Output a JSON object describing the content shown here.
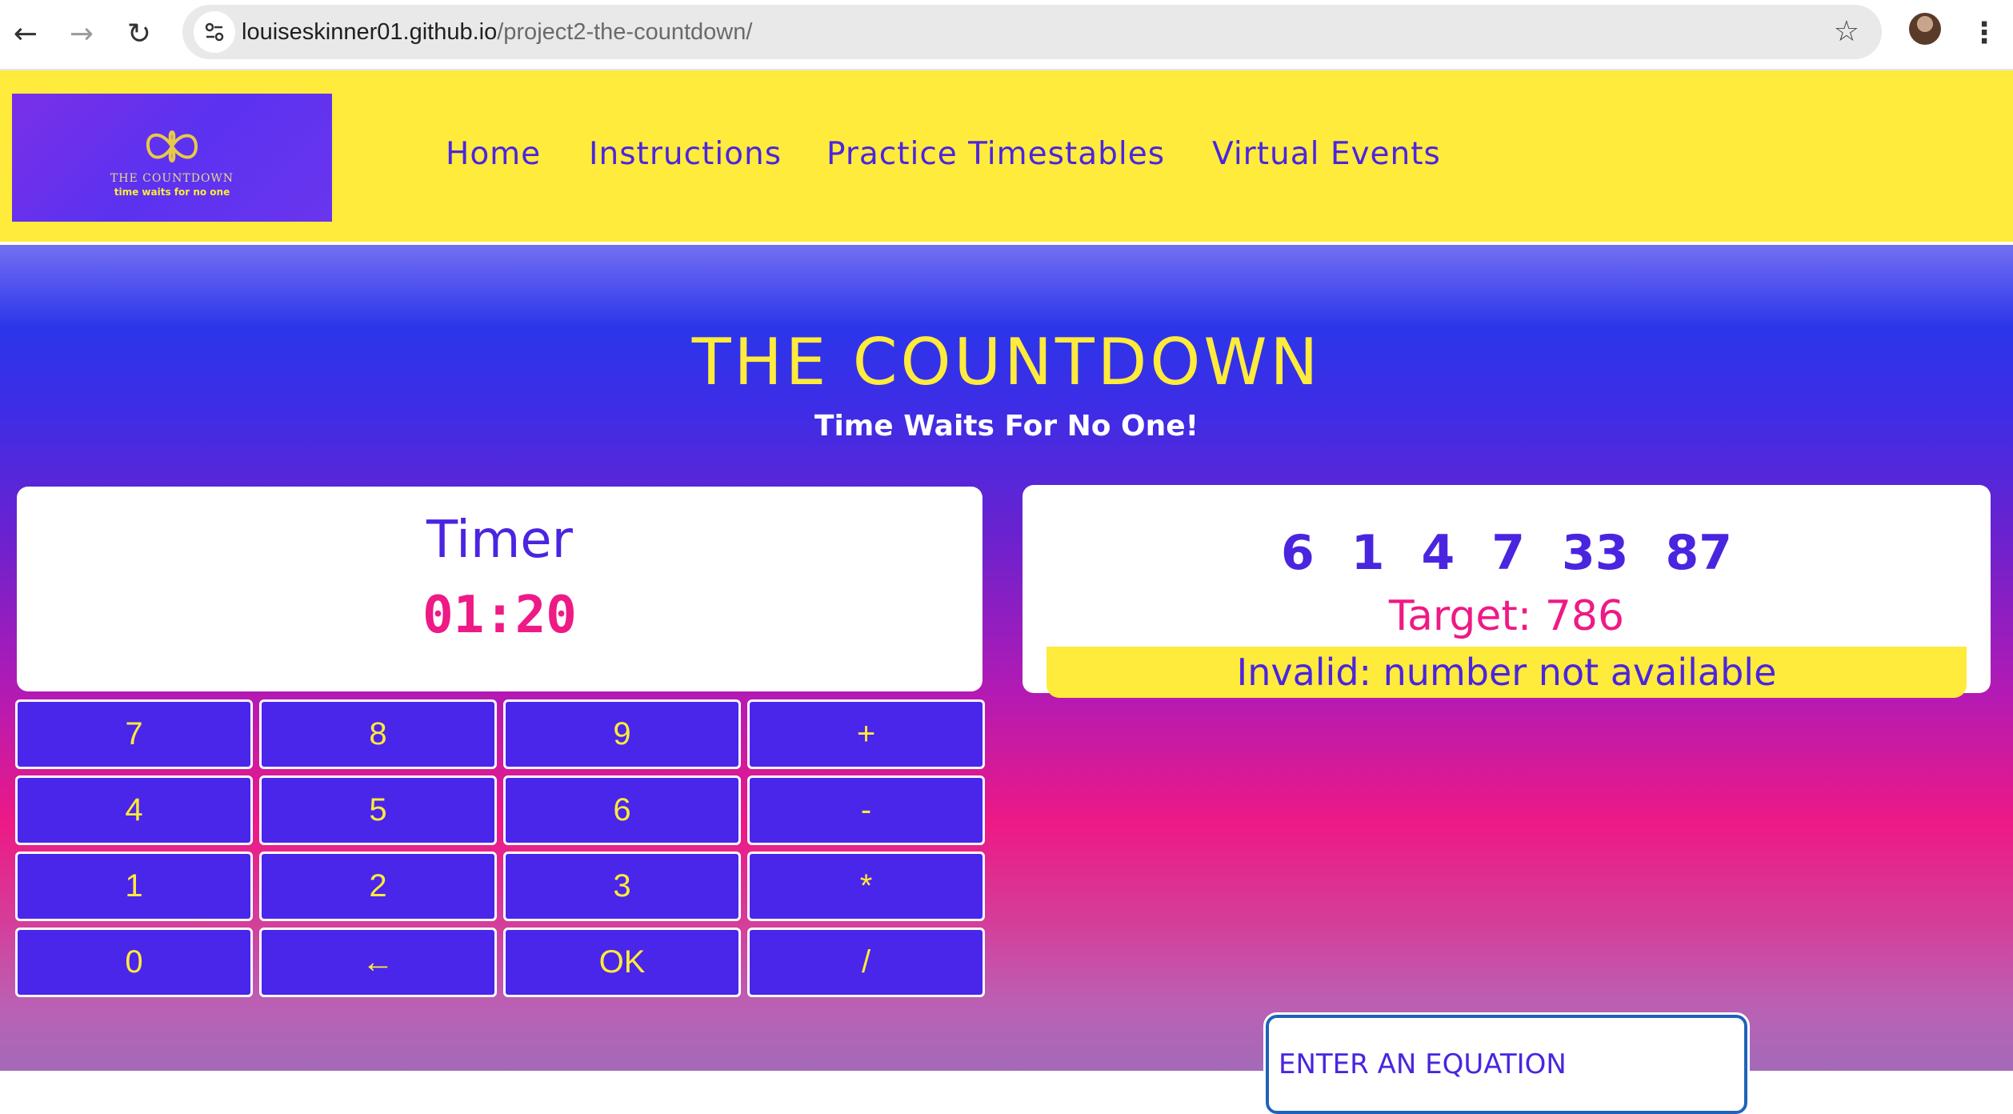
{
  "browser": {
    "url_host": "louiseskinner01.github.io",
    "url_path": "/project2-the-countdown/"
  },
  "logo": {
    "title": "THE COUNTDOWN",
    "tagline": "time waits for no one"
  },
  "nav": {
    "items": [
      {
        "label": "Home"
      },
      {
        "label": "Instructions"
      },
      {
        "label": "Practice Timestables"
      },
      {
        "label": "Virtual Events"
      }
    ]
  },
  "hero": {
    "title": "THE COUNTDOWN",
    "subtitle": "Time Waits For No One!"
  },
  "timer": {
    "label": "Timer",
    "value": "01:20"
  },
  "keypad": {
    "keys": [
      "7",
      "8",
      "9",
      "+",
      "4",
      "5",
      "6",
      "-",
      "1",
      "2",
      "3",
      "*",
      "0",
      "←",
      "OK",
      "/"
    ]
  },
  "game": {
    "numbers": [
      "6",
      "1",
      "4",
      "7",
      "33",
      "87"
    ],
    "target": "Target: 786",
    "message": "Invalid: number not available"
  },
  "equation": {
    "placeholder": "ENTER AN EQUATION",
    "value": ""
  },
  "colors": {
    "accent_yellow": "#ffeb3b",
    "primary_purple": "#4a25e0",
    "pink": "#ee1a86"
  }
}
